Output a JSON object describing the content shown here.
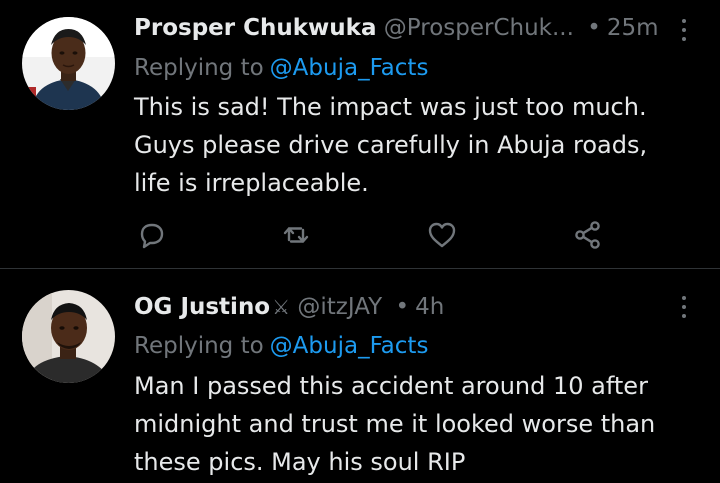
{
  "tweets": [
    {
      "display_name": "Prosper Chukwuka",
      "handle": "@ProsperChuk...",
      "separator": "•",
      "time": "25m",
      "replying_prefix": "Replying to",
      "replying_to": "@Abuja_Facts",
      "body_lines": [
        "This is sad! The impact was just too much.",
        "Guys please drive carefully in Abuja roads,",
        "life is irreplaceable."
      ],
      "avatar_icon": "avatar-photo",
      "actions": [
        "reply-icon",
        "retweet-icon",
        "like-icon",
        "share-icon"
      ]
    },
    {
      "display_name": "OG Justino",
      "name_emoji": "⚔",
      "handle": "@itzJAY",
      "separator": "•",
      "time": "4h",
      "replying_prefix": "Replying to",
      "replying_to": "@Abuja_Facts",
      "body_lines": [
        "Man I passed this accident around 10 after",
        "midnight and trust me it looked worse than",
        "these pics. May his soul RIP"
      ],
      "avatar_icon": "avatar-photo"
    }
  ],
  "colors": {
    "background": "#000000",
    "text": "#e7e9ea",
    "muted": "#71767b",
    "accent": "#1d9bf0",
    "divider": "#2f3336"
  }
}
